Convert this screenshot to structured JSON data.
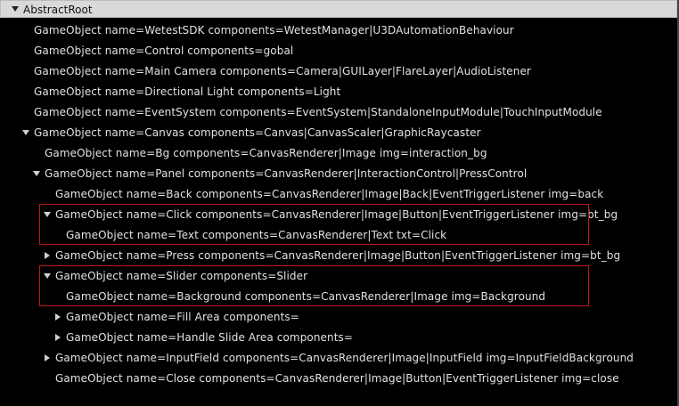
{
  "root": {
    "label": "AbstractRoot"
  },
  "nodes": [
    {
      "id": "wetestsdk",
      "text": "GameObject name=WetestSDK components=WetestManager|U3DAutomationBehaviour"
    },
    {
      "id": "control",
      "text": "GameObject name=Control components=gobal"
    },
    {
      "id": "main-camera",
      "text": "GameObject name=Main Camera components=Camera|GUILayer|FlareLayer|AudioListener"
    },
    {
      "id": "directional-light",
      "text": "GameObject name=Directional Light components=Light"
    },
    {
      "id": "eventsystem",
      "text": "GameObject name=EventSystem components=EventSystem|StandaloneInputModule|TouchInputModule"
    },
    {
      "id": "canvas",
      "text": "GameObject name=Canvas components=Canvas|CanvasScaler|GraphicRaycaster"
    },
    {
      "id": "bg",
      "text": "GameObject name=Bg components=CanvasRenderer|Image img=interaction_bg"
    },
    {
      "id": "panel",
      "text": "GameObject name=Panel components=CanvasRenderer|InteractionControl|PressControl"
    },
    {
      "id": "back",
      "text": "GameObject name=Back components=CanvasRenderer|Image|Back|EventTriggerListener img=back"
    },
    {
      "id": "click",
      "text": "GameObject name=Click components=CanvasRenderer|Image|Button|EventTriggerListener img=bt_bg"
    },
    {
      "id": "text",
      "text": "GameObject name=Text components=CanvasRenderer|Text txt=Click"
    },
    {
      "id": "press",
      "text": "GameObject name=Press components=CanvasRenderer|Image|Button|EventTriggerListener img=bt_bg"
    },
    {
      "id": "slider",
      "text": "GameObject name=Slider components=Slider"
    },
    {
      "id": "background",
      "text": "GameObject name=Background components=CanvasRenderer|Image img=Background"
    },
    {
      "id": "fill-area",
      "text": "GameObject name=Fill Area components="
    },
    {
      "id": "handle-slide-area",
      "text": "GameObject name=Handle Slide Area components="
    },
    {
      "id": "inputfield",
      "text": "GameObject name=InputField components=CanvasRenderer|Image|InputField img=InputFieldBackground"
    },
    {
      "id": "close",
      "text": "GameObject name=Close components=CanvasRenderer|Image|Button|EventTriggerListener img=close"
    }
  ]
}
